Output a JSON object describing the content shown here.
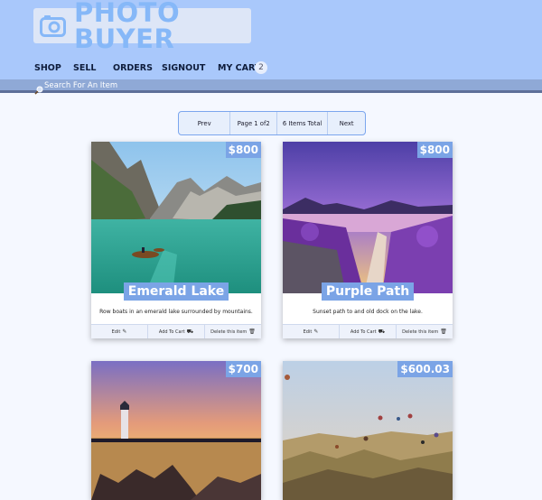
{
  "app": {
    "title": "PHOTO BUYER"
  },
  "nav": {
    "shop": "SHOP",
    "sell": "SELL",
    "orders": "ORDERS",
    "signout": "SIGNOUT",
    "cart": "MY CART",
    "cart_count": "2"
  },
  "search": {
    "placeholder": "Search For An Item"
  },
  "pager": {
    "prev": "Prev",
    "page": "Page 1 of2",
    "total": "6 Items Total",
    "next": "Next"
  },
  "actions": {
    "edit": "Edit",
    "add_to_cart": "Add To Cart",
    "delete": "Delete this item"
  },
  "items": [
    {
      "title": "Emerald Lake",
      "price": "$800",
      "description": "Row boats in an emerald lake surrounded by mountains."
    },
    {
      "title": "Purple Path",
      "price": "$800",
      "description": "Sunset path to and old dock on the lake."
    },
    {
      "title": "",
      "price": "$700",
      "description": ""
    },
    {
      "title": "",
      "price": "$600.03",
      "description": ""
    }
  ],
  "colors": {
    "header_bg": "#a9c8fb",
    "accent": "#7ba4e6",
    "page_bg": "#f5f8ff"
  }
}
